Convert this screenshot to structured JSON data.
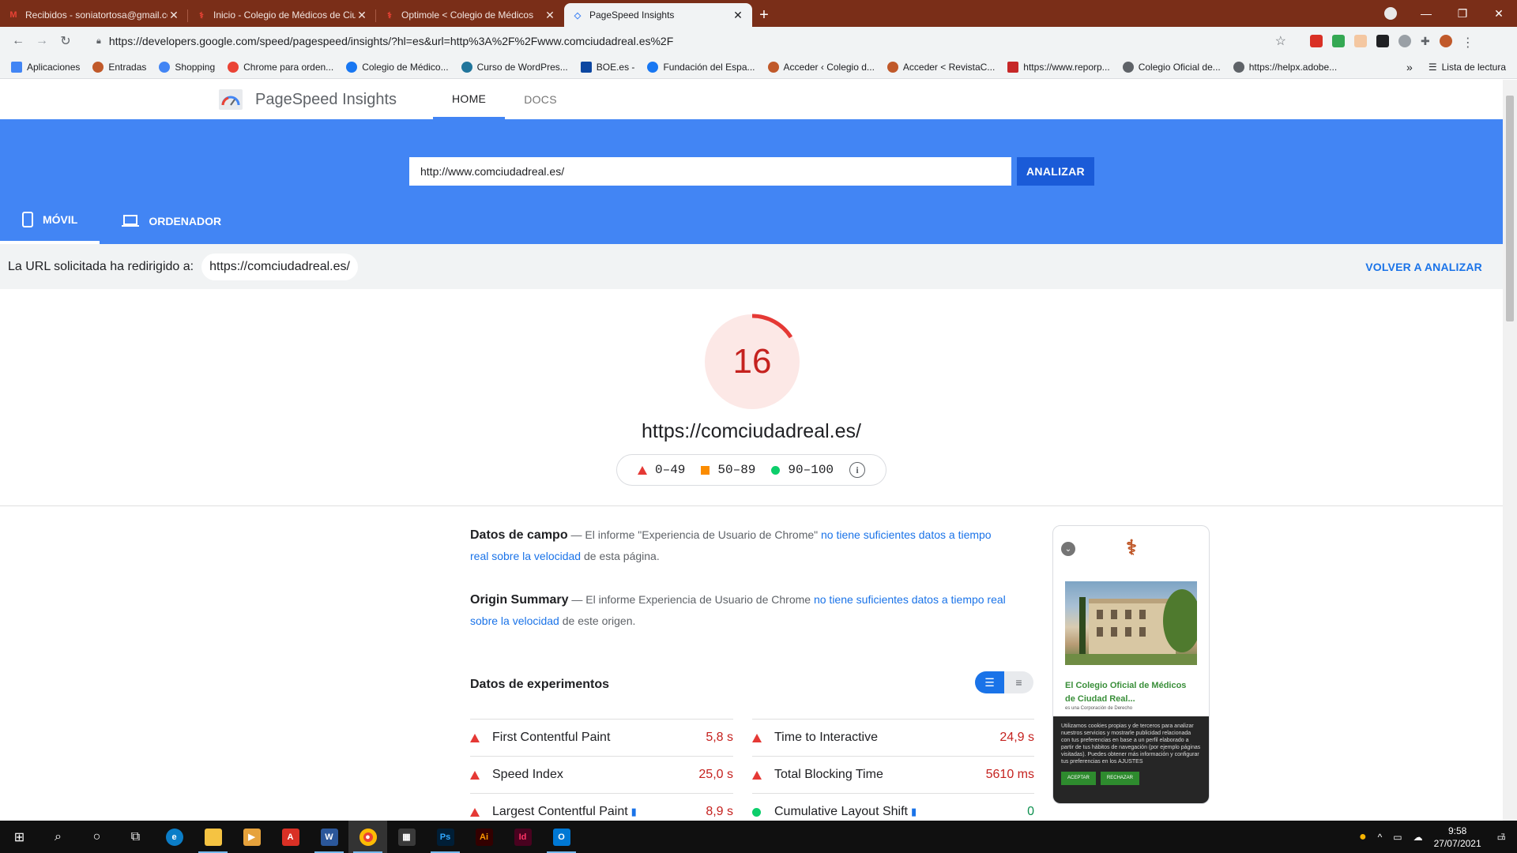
{
  "browser": {
    "tabs": [
      {
        "title": "Recibidos - soniatortosa@gmail.com",
        "icon": "gmail-icon"
      },
      {
        "title": "Inicio - Colegio de Médicos de Ciudad Real",
        "icon": "comcr-icon"
      },
      {
        "title": "Optimole < Colegio de Médicos",
        "icon": "comcr-icon"
      },
      {
        "title": "PageSpeed Insights",
        "icon": "psi-icon"
      }
    ],
    "url": "https://developers.google.com/speed/pagespeed/insights/?hl=es&url=http%3A%2F%2Fwww.comciudadreal.es%2F",
    "bookmarks": [
      "Aplicaciones",
      "Entradas",
      "Shopping",
      "Chrome para orden...",
      "Colegio de Médico...",
      "Curso de WordPres...",
      "BOE.es -",
      "Fundación del Espa...",
      "Acceder ‹ Colegio d...",
      "Acceder < RevistaC...",
      "https://www.reporp...",
      "Colegio Oficial de...",
      "https://helpx.adobe..."
    ],
    "reading_list": "Lista de lectura",
    "more": "»"
  },
  "psi": {
    "title": "PageSpeed Insights",
    "nav": {
      "home": "HOME",
      "docs": "DOCS"
    },
    "input_value": "http://www.comciudadreal.es/",
    "analyze": "ANALIZAR",
    "devices": {
      "mobile": "MÓVIL",
      "desktop": "ORDENADOR"
    },
    "redirect_label": "La URL solicitada ha redirigido a:",
    "redirect_url": "https://comciudadreal.es/",
    "reanalyze": "VOLVER A ANALIZAR",
    "score": "16",
    "score_fraction": 0.16,
    "page_url": "https://comciudadreal.es/",
    "legend": {
      "bad": "0–49",
      "avg": "50–89",
      "good": "90–100"
    },
    "field": {
      "heading": "Datos de campo",
      "dash": " — ",
      "pre": "El informe \"Experiencia de Usuario de Chrome\" ",
      "link": "no tiene suficientes datos a tiempo real sobre la velocidad",
      "post": " de esta página."
    },
    "origin": {
      "heading": "Origin Summary",
      "dash": " — ",
      "pre": "El informe Experiencia de Usuario de Chrome ",
      "link": "no tiene suficientes datos a tiempo real sobre la velocidad",
      "post": " de este origen."
    },
    "lab_title": "Datos de experimentos",
    "metrics": [
      [
        {
          "name": "First Contentful Paint",
          "value": "5,8 s",
          "status": "bad",
          "flag": false
        },
        {
          "name": "Time to Interactive",
          "value": "24,9 s",
          "status": "bad",
          "flag": false
        }
      ],
      [
        {
          "name": "Speed Index",
          "value": "25,0 s",
          "status": "bad",
          "flag": false
        },
        {
          "name": "Total Blocking Time",
          "value": "5610 ms",
          "status": "bad",
          "flag": false
        }
      ],
      [
        {
          "name": "Largest Contentful Paint",
          "value": "8,9 s",
          "status": "bad",
          "flag": true
        },
        {
          "name": "Cumulative Layout Shift",
          "value": "0",
          "status": "good",
          "flag": true
        }
      ]
    ],
    "preview": {
      "title": "El Colegio Oficial de Médicos de Ciudad Real...",
      "subtitle": "es una Corporación de Derecho",
      "cookie_text": "Utilizamos cookies propias y de terceros para analizar nuestros servicios y mostrarle publicidad relacionada con tus preferencias en base a un perfil elaborado a partir de tus hábitos de navegación (por ejemplo páginas visitadas). Puedes obtener más información y configurar tus preferencias en los AJUSTES",
      "accept": "ACEPTAR",
      "reject": "RECHAZAR"
    }
  },
  "colors": {
    "accent": "#4285f4",
    "bad": "#c5221f",
    "good": "#0d904f",
    "tab_strip": "#7a2e18"
  },
  "taskbar": {
    "time": "9:58",
    "date": "27/07/2021",
    "notifications": "7"
  }
}
